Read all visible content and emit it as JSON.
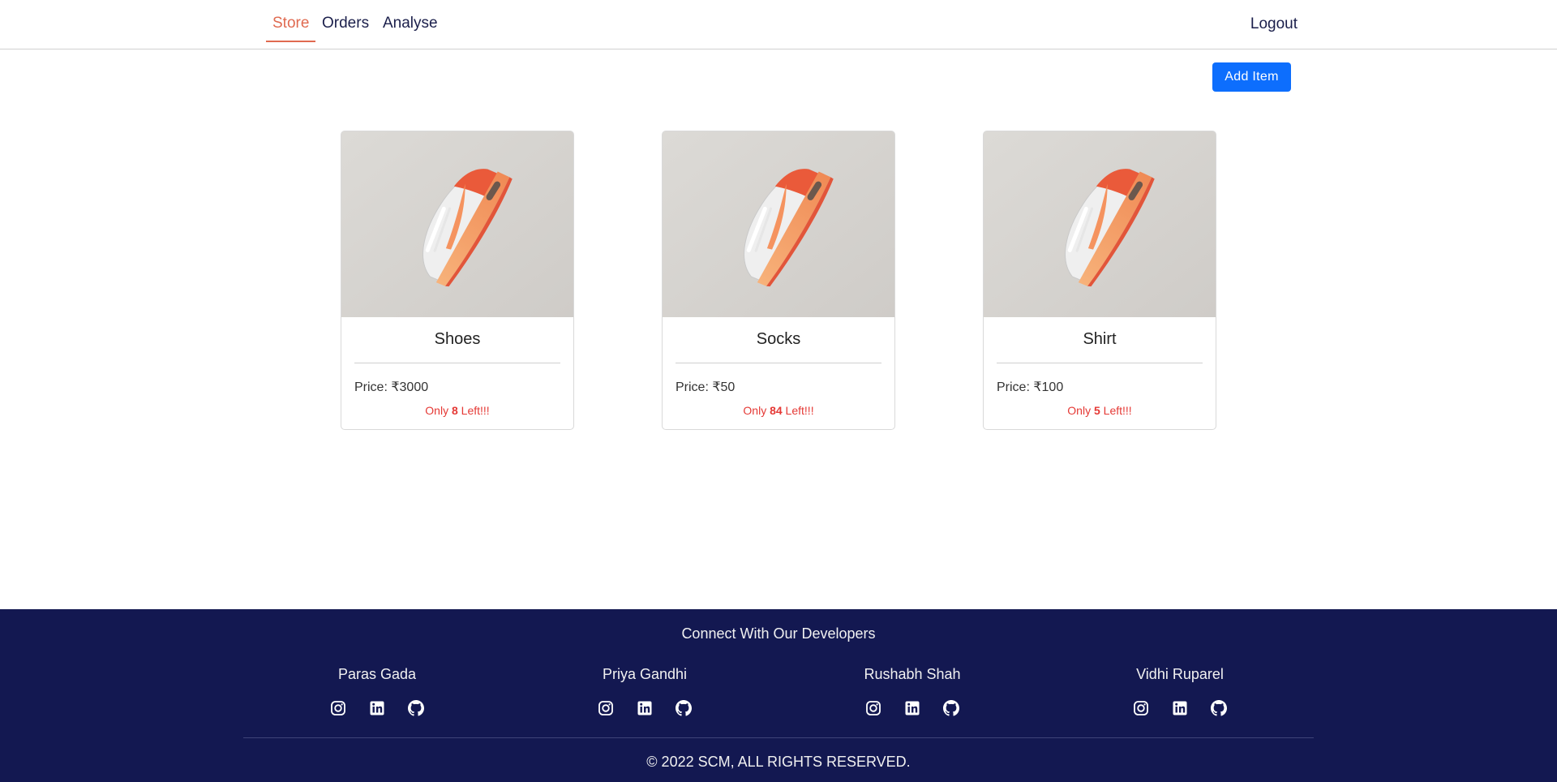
{
  "nav": {
    "tabs": [
      {
        "label": "Store",
        "active": true
      },
      {
        "label": "Orders",
        "active": false
      },
      {
        "label": "Analyse",
        "active": false
      }
    ],
    "logout_label": "Logout"
  },
  "toolbar": {
    "add_item_label": "Add Item"
  },
  "products": [
    {
      "name": "Shoes",
      "price": "Price: ₹3000",
      "stock_prefix": "Only ",
      "stock_count": "8",
      "stock_suffix": " Left!!!",
      "image_icon": "sneaker-image"
    },
    {
      "name": "Socks",
      "price": "Price: ₹50",
      "stock_prefix": "Only ",
      "stock_count": "84",
      "stock_suffix": " Left!!!",
      "image_icon": "sneaker-image"
    },
    {
      "name": "Shirt",
      "price": "Price: ₹100",
      "stock_prefix": "Only ",
      "stock_count": "5",
      "stock_suffix": " Left!!!",
      "image_icon": "sneaker-image"
    }
  ],
  "footer": {
    "heading": "Connect With Our Developers",
    "developers": [
      {
        "name": "Paras Gada",
        "icons": [
          "instagram-icon",
          "linkedin-icon",
          "github-icon"
        ]
      },
      {
        "name": "Priya Gandhi",
        "icons": [
          "instagram-icon",
          "linkedin-icon",
          "github-icon"
        ]
      },
      {
        "name": "Rushabh Shah",
        "icons": [
          "instagram-icon",
          "linkedin-icon",
          "github-icon"
        ]
      },
      {
        "name": "Vidhi Ruparel",
        "icons": [
          "instagram-icon",
          "linkedin-icon",
          "github-icon"
        ]
      }
    ],
    "copyright": "© 2022 SCM, ALL RIGHTS RESERVED."
  },
  "colors": {
    "accent": "#e06a50",
    "nav_text": "#1b1f4b",
    "button": "#0d6efd",
    "stock_text": "#e53935",
    "footer_bg": "#131851"
  }
}
